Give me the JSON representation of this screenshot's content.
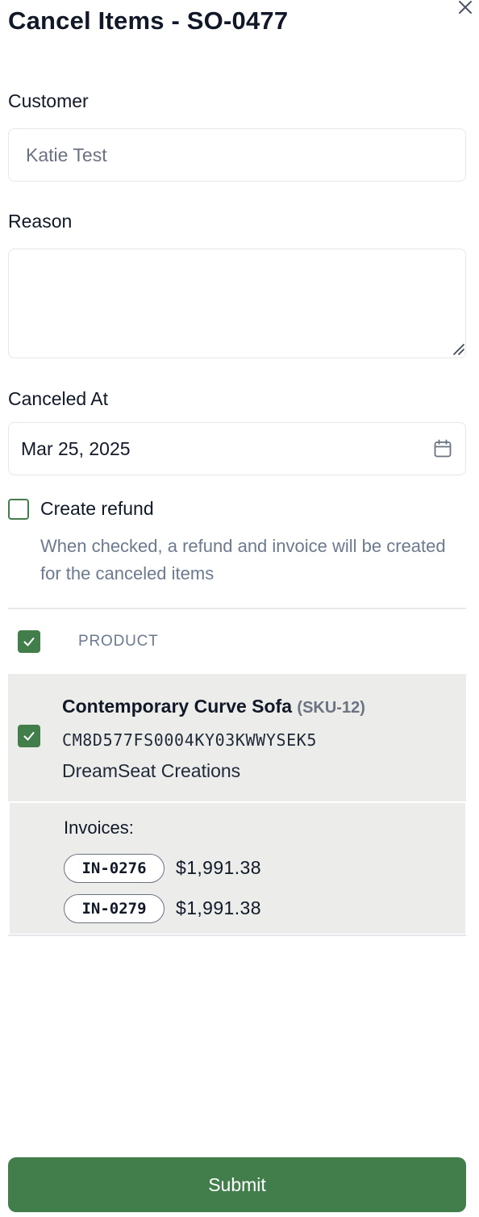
{
  "dialog": {
    "title": "Cancel Items - SO-0477"
  },
  "icons": {
    "close": "close-icon",
    "calendar": "calendar-icon",
    "check": "check-icon"
  },
  "colors": {
    "accent": "#417e4c",
    "row_bg": "#ecedea",
    "muted_text": "#6b7a8f"
  },
  "form": {
    "customer_label": "Customer",
    "customer_value": "Katie Test",
    "reason_label": "Reason",
    "reason_value": "",
    "canceled_at_label": "Canceled At",
    "canceled_at_value": "Mar 25, 2025",
    "create_refund_label": "Create refund",
    "create_refund_checked": false,
    "create_refund_help": "When checked, a refund and invoice will be created for the canceled items"
  },
  "table": {
    "header_checked": true,
    "column_product": "PRODUCT",
    "rows": [
      {
        "checked": true,
        "name": "Contemporary Curve Sofa",
        "sku": "(SKU-12)",
        "code": "CM8D577FS0004KY03KWWYSEK5",
        "vendor": "DreamSeat Creations",
        "invoices_label": "Invoices:",
        "invoices": [
          {
            "id": "IN-0276",
            "amount": "$1,991.38"
          },
          {
            "id": "IN-0279",
            "amount": "$1,991.38"
          }
        ]
      }
    ]
  },
  "actions": {
    "submit_label": "Submit"
  }
}
